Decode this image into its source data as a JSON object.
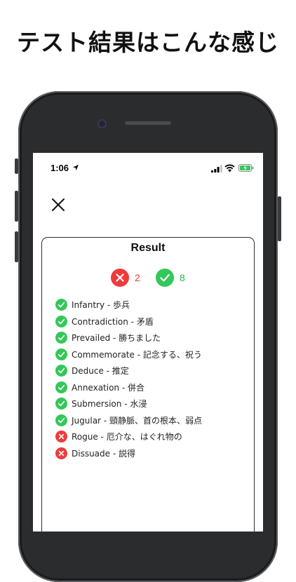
{
  "headline": "テスト結果はこんな感じ",
  "status_bar": {
    "time": "1:06"
  },
  "card": {
    "title": "Result",
    "summary": {
      "wrong_count": "2",
      "correct_count": "8"
    },
    "items": [
      {
        "text": "Infantry - 歩兵",
        "status": "correct"
      },
      {
        "text": "Contradiction  - 矛盾",
        "status": "correct"
      },
      {
        "text": "Prevailed  - 勝ちました",
        "status": "correct"
      },
      {
        "text": "Commemorate - 記念する、祝う",
        "status": "correct"
      },
      {
        "text": "Deduce - 推定",
        "status": "correct"
      },
      {
        "text": "Annexation  - 併合",
        "status": "correct"
      },
      {
        "text": "Submersion  - 水浸",
        "status": "correct"
      },
      {
        "text": "Jugular  - 頸静脈、首の根本、弱点",
        "status": "correct"
      },
      {
        "text": "Rogue - 厄介な、はぐれ物の",
        "status": "wrong"
      },
      {
        "text": "Dissuade  - 説得",
        "status": "wrong"
      }
    ]
  },
  "colors": {
    "correct": "#34c759",
    "wrong": "#ef3b3b",
    "frame": "#2b2c2e"
  },
  "icons": {
    "close": "close-icon",
    "location": "location-arrow-icon",
    "signal": "cellular-signal-icon",
    "wifi": "wifi-icon",
    "battery": "battery-charging-icon",
    "correct": "check-circle-icon",
    "wrong": "x-circle-icon"
  }
}
